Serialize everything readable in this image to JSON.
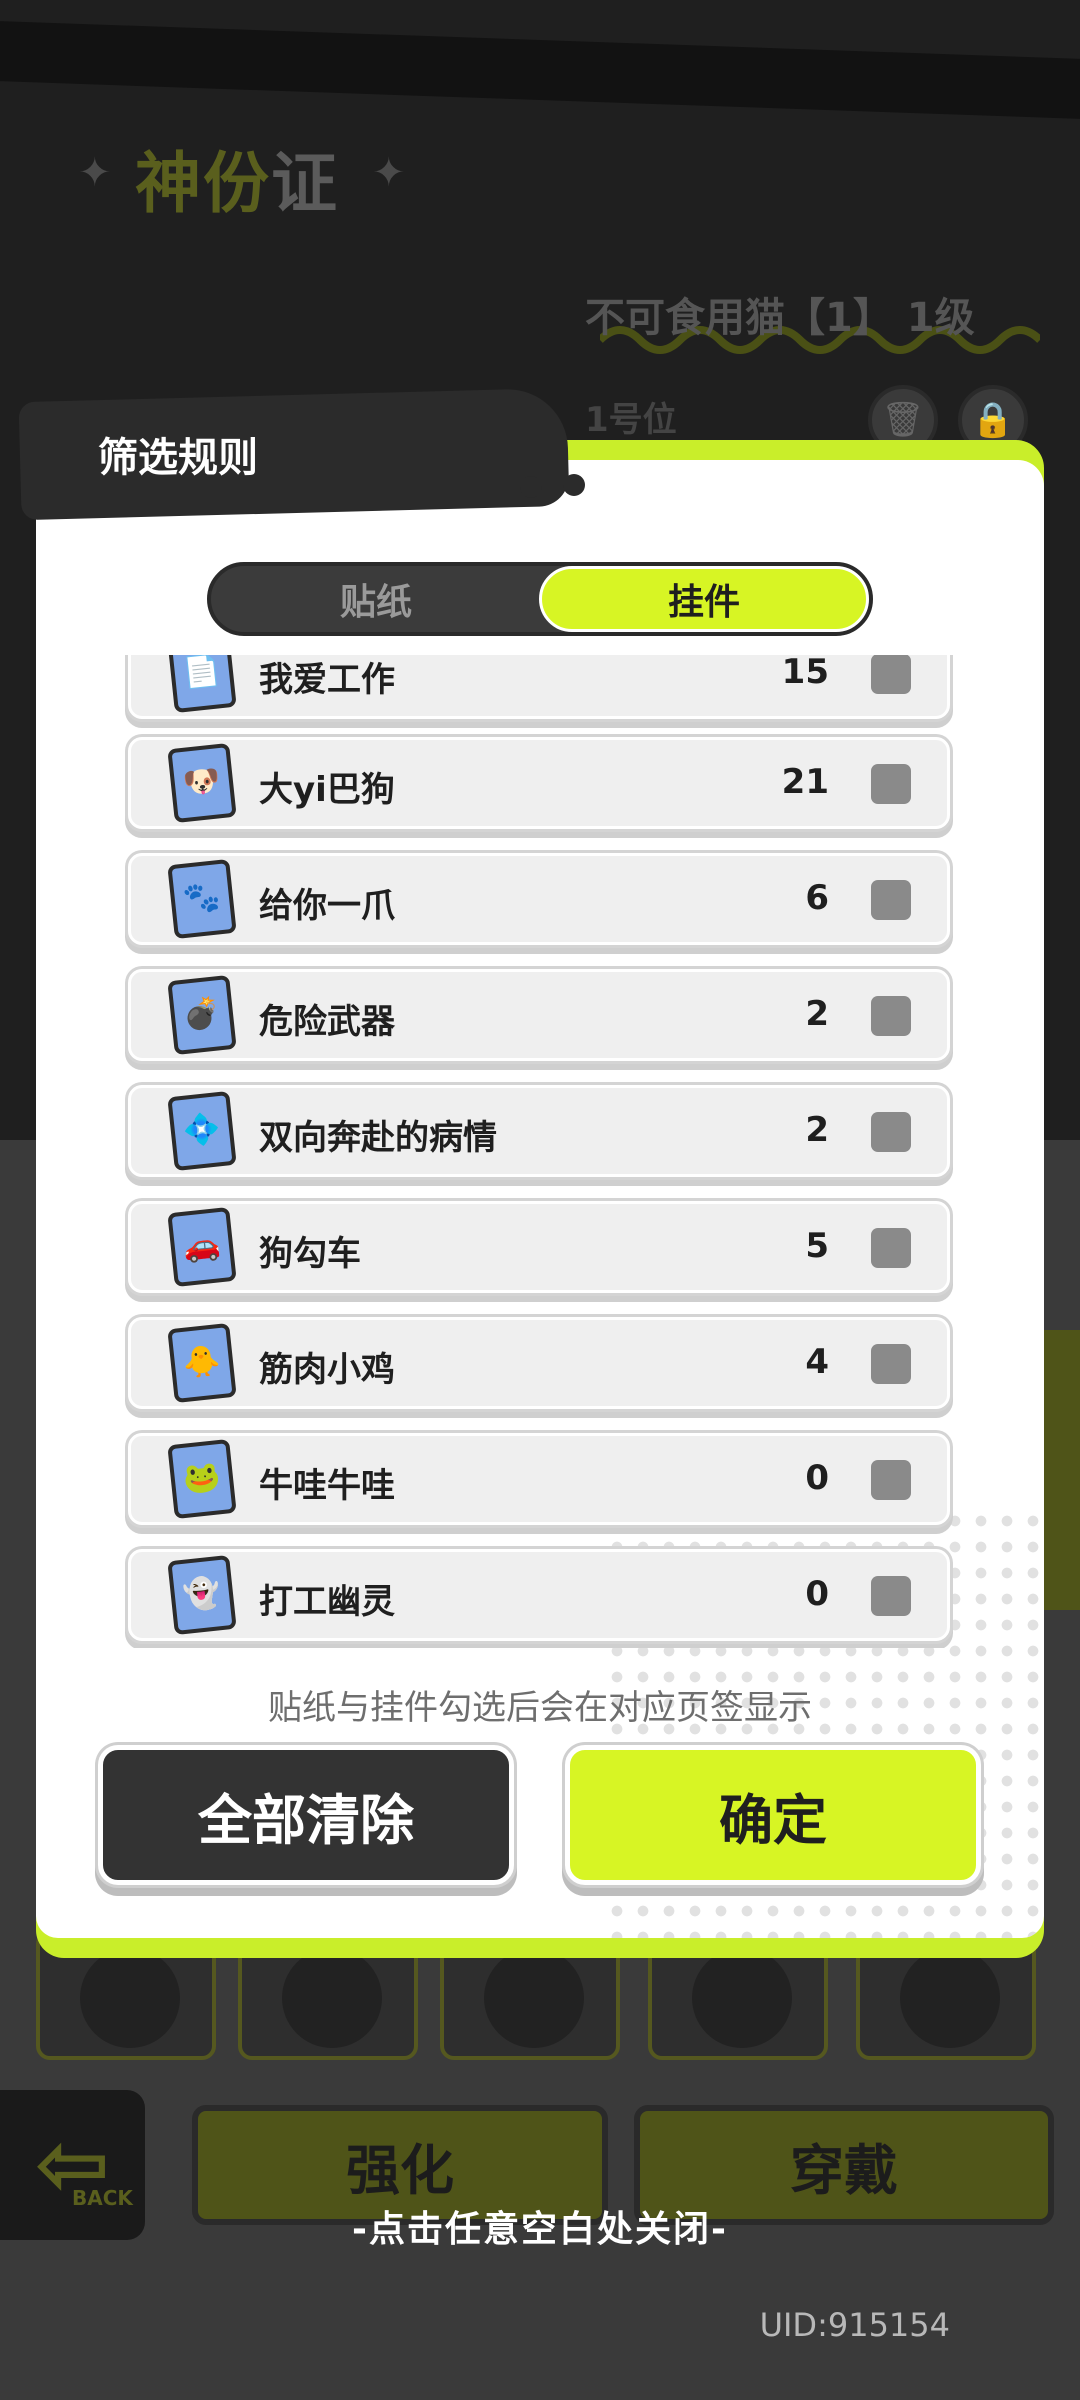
{
  "background": {
    "title_part1": "神份",
    "title_part2": "证",
    "cat_label": "不可食用猫【1】 1级",
    "slot_label": "1号位",
    "back_label": "BACK",
    "enhance_label": "强化",
    "wear_label": "穿戴"
  },
  "modal": {
    "title": "筛选规则",
    "tabs": {
      "stickers": "贴纸",
      "pendants": "挂件"
    },
    "active_tab": "挂件",
    "items": [
      {
        "name": "我爱工作",
        "count": "15",
        "icon": "📄",
        "checked": false
      },
      {
        "name": "大yi巴狗",
        "count": "21",
        "icon": "🐶",
        "checked": false
      },
      {
        "name": "给你一爪",
        "count": "6",
        "icon": "🐾",
        "checked": false
      },
      {
        "name": "危险武器",
        "count": "2",
        "icon": "💣",
        "checked": false
      },
      {
        "name": "双向奔赴的病情",
        "count": "2",
        "icon": "💠",
        "checked": false
      },
      {
        "name": "狗勾车",
        "count": "5",
        "icon": "🚗",
        "checked": false
      },
      {
        "name": "筋肉小鸡",
        "count": "4",
        "icon": "🐥",
        "checked": false
      },
      {
        "name": "牛哇牛哇",
        "count": "0",
        "icon": "🐸",
        "checked": false
      },
      {
        "name": "打工幽灵",
        "count": "0",
        "icon": "👻",
        "checked": false
      }
    ],
    "note": "贴纸与挂件勾选后会在对应页签显示",
    "clear_all_label": "全部清除",
    "confirm_label": "确定"
  },
  "close_hint": "-点击任意空白处关闭-",
  "uid": "UID:915154",
  "colors": {
    "accent": "#d7f524",
    "dark": "#333333",
    "check": "#8a8a8a"
  }
}
